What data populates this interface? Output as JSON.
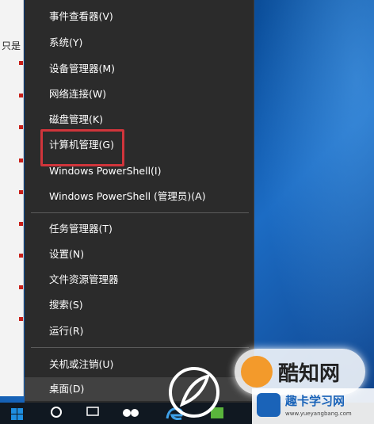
{
  "background_window": {
    "stub_text": "只是"
  },
  "menu": {
    "items": [
      {
        "label": "事件查看器(V)"
      },
      {
        "label": "系统(Y)"
      },
      {
        "label": "设备管理器(M)"
      },
      {
        "label": "网络连接(W)"
      },
      {
        "label": "磁盘管理(K)"
      },
      {
        "label": "计算机管理(G)"
      },
      {
        "label": "Windows PowerShell(I)"
      },
      {
        "label": "Windows PowerShell (管理员)(A)"
      },
      {
        "label": "任务管理器(T)"
      },
      {
        "label": "设置(N)"
      },
      {
        "label": "文件资源管理器"
      },
      {
        "label": "搜索(S)"
      },
      {
        "label": "运行(R)"
      },
      {
        "label": "关机或注销(U)"
      },
      {
        "label": "桌面(D)"
      }
    ],
    "highlighted_item": "桌面(D)",
    "annotated_item": "计算机管理(G)"
  },
  "watermark": {
    "circle_text": "酷知网",
    "brand_text": "趣卡学习网",
    "url_text": "www.yueyangbang.com"
  },
  "colors": {
    "menu_bg": "#2b2b2b",
    "menu_text": "#ffffff",
    "highlight_bg": "#414141",
    "annotation_red": "#d0353b",
    "taskbar_bg": "#101821",
    "windows_blue": "#1e8ee0"
  },
  "icons": [
    "windows-logo-icon",
    "search-icon",
    "task-view-icon",
    "edge-icon",
    "folder-icon",
    "store-icon"
  ]
}
